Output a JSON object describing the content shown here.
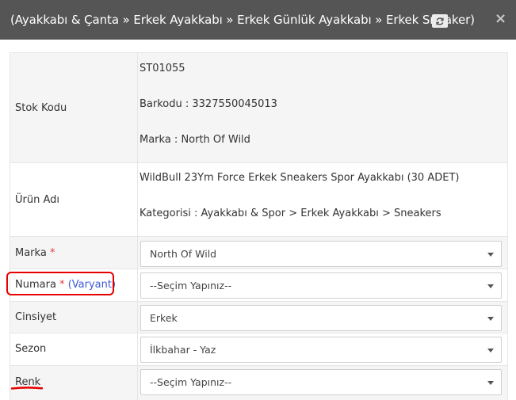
{
  "header": {
    "title": "(Ayakkabı & Çanta » Erkek Ayakkabı » Erkek Günlük Ayakkabı » Erkek Sneaker)",
    "close_symbol": "×"
  },
  "stok": {
    "label": "Stok Kodu",
    "code": "ST01055",
    "barcode": "Barkodu : 3327550045013",
    "brand": "Marka : North Of Wild"
  },
  "urun": {
    "label": "Ürün Adı",
    "name": "WildBull 23Ym Force Erkek Sneakers Spor Ayakkabı (30 ADET)",
    "category": "Kategorisi : Ayakkabı & Spor > Erkek Ayakkabı > Sneakers"
  },
  "fields": {
    "marka": {
      "label": "Marka",
      "required": "*",
      "value": "North Of Wild"
    },
    "numara": {
      "label": "Numara",
      "required": "*",
      "variant": "(Varyant)",
      "value": "--Seçim Yapınız--"
    },
    "cinsiyet": {
      "label": "Cinsiyet",
      "value": "Erkek"
    },
    "sezon": {
      "label": "Sezon",
      "value": "İlkbahar - Yaz"
    },
    "renk": {
      "label": "Renk",
      "value": "--Seçim Yapınız--"
    }
  },
  "colors": {
    "header_bg": "#555555",
    "stripe_bg": "#f5f5f5",
    "required": "#e03b3b",
    "variant": "#3c5bd6",
    "highlight": "#e60000"
  }
}
